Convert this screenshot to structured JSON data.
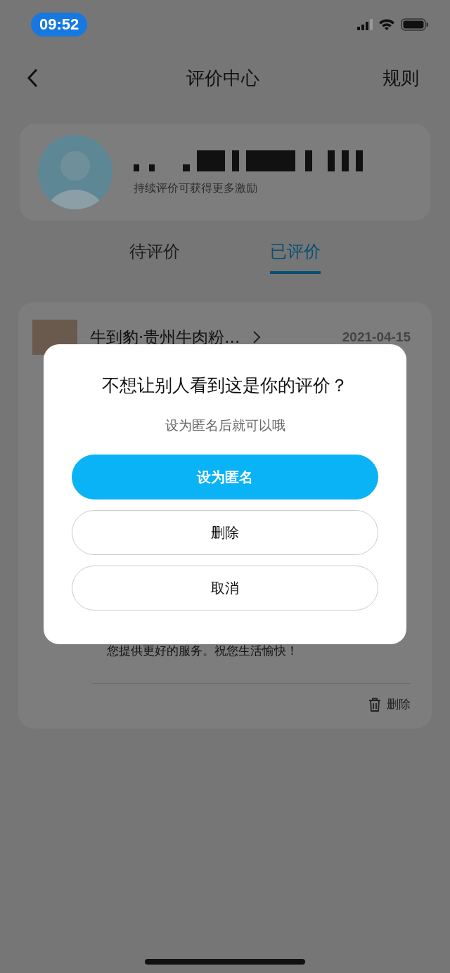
{
  "status_bar": {
    "time": "09:52"
  },
  "nav": {
    "title": "评价中心",
    "action": "规则"
  },
  "profile": {
    "subtitle": "持续评价可获得更多激励"
  },
  "tabs": [
    {
      "label": "待评价",
      "selected": false
    },
    {
      "label": "已评价",
      "selected": true
    }
  ],
  "review": {
    "shop": "牛到豹·贵州牛肉粉...",
    "date": "2021-04-15",
    "comment": "您提供更好的服务。祝您生活愉快！",
    "delete": "删除"
  },
  "dialog": {
    "title": "不想让别人看到这是你的评价？",
    "subtitle": "设为匿名后就可以哦",
    "buttons": [
      {
        "label": "设为匿名",
        "kind": "primary"
      },
      {
        "label": "删除",
        "kind": "outline"
      },
      {
        "label": "取消",
        "kind": "outline"
      }
    ]
  }
}
